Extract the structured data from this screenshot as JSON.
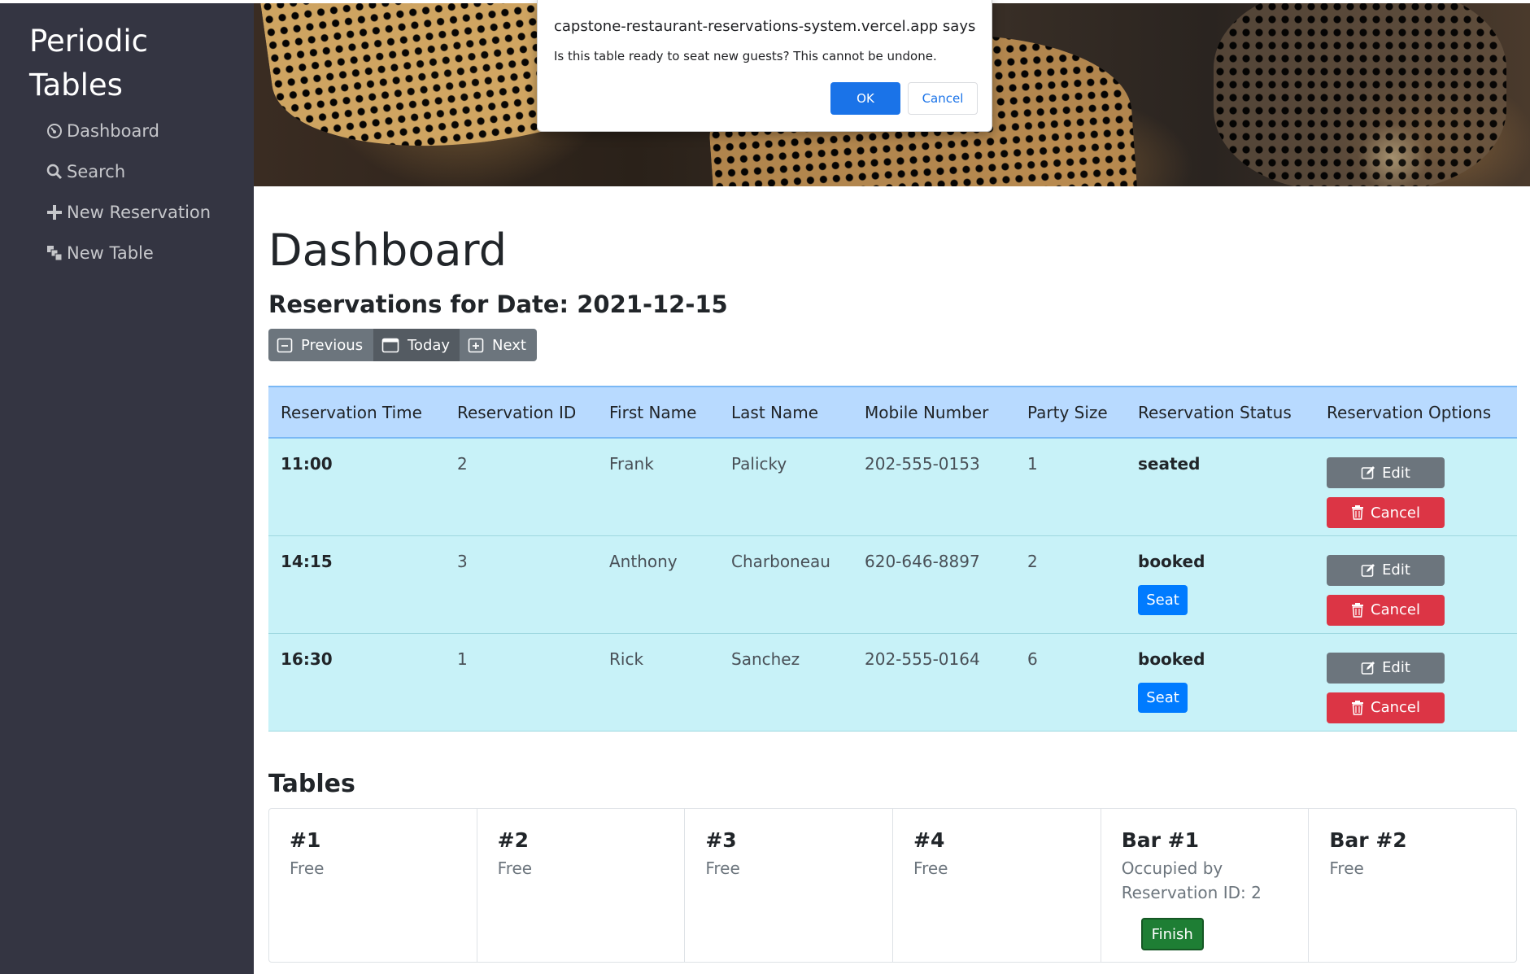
{
  "sidebar": {
    "brand": "Periodic Tables",
    "items": [
      {
        "label": "Dashboard",
        "icon": "dashboard-icon"
      },
      {
        "label": "Search",
        "icon": "search-icon"
      },
      {
        "label": "New Reservation",
        "icon": "plus-icon"
      },
      {
        "label": "New Table",
        "icon": "table-icon"
      }
    ]
  },
  "dialog": {
    "title": "capstone-restaurant-reservations-system.vercel.app says",
    "message": "Is this table ready to seat new guests? This cannot be undone.",
    "ok_label": "OK",
    "cancel_label": "Cancel"
  },
  "main": {
    "title": "Dashboard",
    "date_heading": "Reservations for Date: 2021-12-15",
    "nav": {
      "previous": "Previous",
      "today": "Today",
      "next": "Next"
    }
  },
  "reservations": {
    "columns": [
      "Reservation Time",
      "Reservation ID",
      "First Name",
      "Last Name",
      "Mobile Number",
      "Party Size",
      "Reservation Status",
      "Reservation Options"
    ],
    "rows": [
      {
        "time": "11:00",
        "id": "2",
        "first": "Frank",
        "last": "Palicky",
        "mobile": "202-555-0153",
        "party": "1",
        "status": "seated",
        "seat_label": "",
        "edit_label": "Edit",
        "cancel_label": "Cancel"
      },
      {
        "time": "14:15",
        "id": "3",
        "first": "Anthony",
        "last": "Charboneau",
        "mobile": "620-646-8897",
        "party": "2",
        "status": "booked",
        "seat_label": "Seat",
        "edit_label": "Edit",
        "cancel_label": "Cancel"
      },
      {
        "time": "16:30",
        "id": "1",
        "first": "Rick",
        "last": "Sanchez",
        "mobile": "202-555-0164",
        "party": "6",
        "status": "booked",
        "seat_label": "Seat",
        "edit_label": "Edit",
        "cancel_label": "Cancel"
      }
    ]
  },
  "tables": {
    "title": "Tables",
    "cards": [
      {
        "name": "#1",
        "status": "Free"
      },
      {
        "name": "#2",
        "status": "Free"
      },
      {
        "name": "#3",
        "status": "Free"
      },
      {
        "name": "#4",
        "status": "Free"
      },
      {
        "name": "Bar #1",
        "status": "Occupied by Reservation ID: 2",
        "finish_label": "Finish"
      },
      {
        "name": "Bar #2",
        "status": "Free"
      }
    ]
  },
  "colors": {
    "sidebar_bg": "#343542",
    "primary": "#007bff",
    "danger": "#dc3545",
    "secondary": "#6c757d",
    "success": "#1e7e34",
    "table_header": "#b8daff",
    "table_row": "#c8f2f8"
  }
}
